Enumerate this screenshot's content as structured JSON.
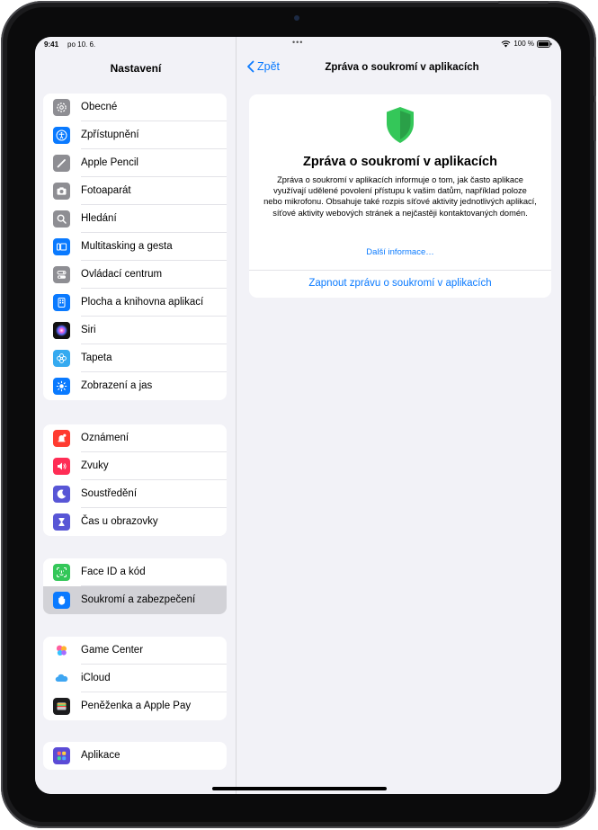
{
  "status_bar": {
    "time": "9:41",
    "date": "po 10. 6.",
    "battery": "100 %"
  },
  "sidebar": {
    "title": "Nastavení",
    "groups": [
      [
        {
          "label": "Obecné",
          "icon": "gear-icon",
          "color": "#8e8e93"
        },
        {
          "label": "Zpřístupnění",
          "icon": "accessibility-icon",
          "color": "#0a7aff"
        },
        {
          "label": "Apple Pencil",
          "icon": "pencil-icon",
          "color": "#8e8e93"
        },
        {
          "label": "Fotoaparát",
          "icon": "camera-icon",
          "color": "#8e8e93"
        },
        {
          "label": "Hledání",
          "icon": "search-icon",
          "color": "#8e8e93"
        },
        {
          "label": "Multitasking a gesta",
          "icon": "multitasking-icon",
          "color": "#0a7aff"
        },
        {
          "label": "Ovládací centrum",
          "icon": "control-center-icon",
          "color": "#8e8e93"
        },
        {
          "label": "Plocha a knihovna aplikací",
          "icon": "home-screen-icon",
          "color": "#0a7aff"
        },
        {
          "label": "Siri",
          "icon": "siri-icon",
          "color": "#222222"
        },
        {
          "label": "Tapeta",
          "icon": "wallpaper-icon",
          "color": "#35aaf0"
        },
        {
          "label": "Zobrazení a jas",
          "icon": "brightness-icon",
          "color": "#0a7aff"
        }
      ],
      [
        {
          "label": "Oznámení",
          "icon": "notifications-icon",
          "color": "#ff3b30"
        },
        {
          "label": "Zvuky",
          "icon": "sounds-icon",
          "color": "#ff2d55"
        },
        {
          "label": "Soustředění",
          "icon": "focus-moon-icon",
          "color": "#5856d6"
        },
        {
          "label": "Čas u obrazovky",
          "icon": "hourglass-icon",
          "color": "#5856d6"
        }
      ],
      [
        {
          "label": "Face ID a kód",
          "icon": "face-id-icon",
          "color": "#34c759"
        },
        {
          "label": "Soukromí a zabezpečení",
          "icon": "privacy-hand-icon",
          "color": "#0a7aff",
          "selected": true
        }
      ],
      [
        {
          "label": "Game Center",
          "icon": "game-center-icon",
          "color": "#ffffff"
        },
        {
          "label": "iCloud",
          "icon": "icloud-icon",
          "color": "#ffffff"
        },
        {
          "label": "Peněženka a Apple Pay",
          "icon": "wallet-icon",
          "color": "#1c1c1e"
        }
      ],
      [
        {
          "label": "Aplikace",
          "icon": "apps-grid-icon",
          "color": "#5b4bd6"
        }
      ]
    ]
  },
  "detail": {
    "back_label": "Zpět",
    "title": "Zpráva o soukromí v aplikacích",
    "card": {
      "heading": "Zpráva o soukromí v aplikacích",
      "description": "Zpráva o soukromí v aplikacích informuje o tom, jak často aplikace využívají udělené povolení přístupu k vašim datům, například poloze nebo mikrofonu. Obsahuje také rozpis síťové aktivity jednotlivých aplikací, síťové aktivity webových stránek a nejčastěji kontaktovaných domén.",
      "more_link": "Další informace…",
      "action": "Zapnout zprávu o soukromí v aplikacích"
    },
    "accent_color": "#0a7aff",
    "shield_color": "#34c759"
  }
}
